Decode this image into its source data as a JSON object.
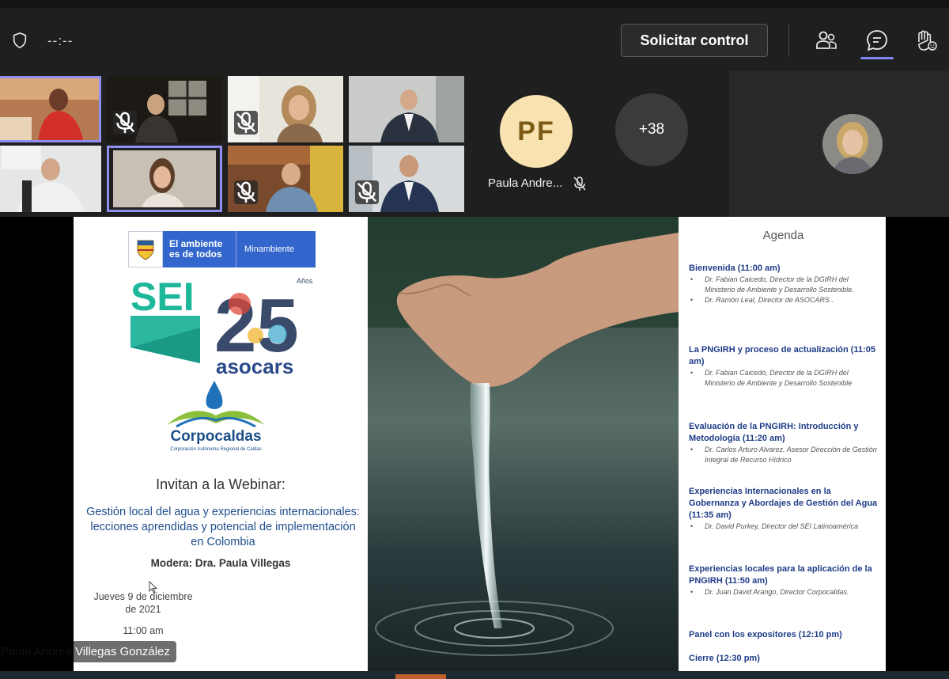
{
  "topbar": {
    "timer": "--:--",
    "request_control_label": "Solicitar control",
    "icons": [
      "shield-icon",
      "people-icon",
      "chat-icon",
      "raise-hand-icon"
    ]
  },
  "gallery": {
    "tiles_muted": [
      false,
      true,
      true,
      false,
      false,
      false,
      true,
      true
    ],
    "active_tiles": [
      0,
      5
    ],
    "pf_initials": "PF",
    "pf_name": "Paula Andre...",
    "more_count": "+38"
  },
  "slide": {
    "gov_text": "El ambiente es de todos",
    "gov_ministry": "Minambiente",
    "sei": "SEI",
    "anniversary": "25",
    "anniversary_sup": "Años",
    "asocars": "asocars",
    "corpocaldas": "Corpocaldas",
    "corpocaldas_sub": "Corporación Autónoma Regional de Caldas",
    "invitan": "Invitan a la Webinar:",
    "topic": "Gestión local del agua y experiencias internacionales: lecciones aprendidas y potencial de implementación en Colombia",
    "modera": "Modera: Dra. Paula Villegas",
    "date": "Jueves 9 de diciembre de 2021",
    "time": "11:00 am",
    "agenda_title": "Agenda",
    "agenda": [
      {
        "title": "Bienvenida (11:00 am)",
        "speakers": [
          "Dr. Fabian Caicedo, Director de la DGIRH del Ministerio de Ambiente y Desarrollo Sostenible.",
          "Dr. Ramón Leal, Director de ASOCARS ."
        ]
      },
      {
        "title": "La PNGIRH y proceso de actualización (11:05 am)",
        "speakers": [
          "Dr. Fabian Caicedo, Director de la DGIRH del Ministerio de Ambiente y Desarrollo Sostenible"
        ]
      },
      {
        "title": "Evaluación de la PNGIRH: Introducción y Metodología (11:20 am)",
        "speakers": [
          "Dr. Carlos Arturo Alvarez. Asesor Dirección de Gestión Integral de Recurso Hídrico"
        ]
      },
      {
        "title": "Experiencias Internacionales en la Gobernanza y Abordajes de Gestión del Agua (11:35 am)",
        "speakers": [
          "Dr. David Purkey, Director del SEI Latinoamérica"
        ]
      },
      {
        "title": "Experiencias locales para la aplicación de la PNGIRH (11:50 am)",
        "speakers": [
          "Dr. Juan David Arango, Director Corpocaldas."
        ]
      },
      {
        "title": "Panel con los expositores (12:10 pm)",
        "speakers": []
      },
      {
        "title": "Cierre (12:30 pm)",
        "speakers": []
      }
    ]
  },
  "presenter": {
    "name_first": "Paula Andrea",
    "name_last": "Villegas González"
  }
}
